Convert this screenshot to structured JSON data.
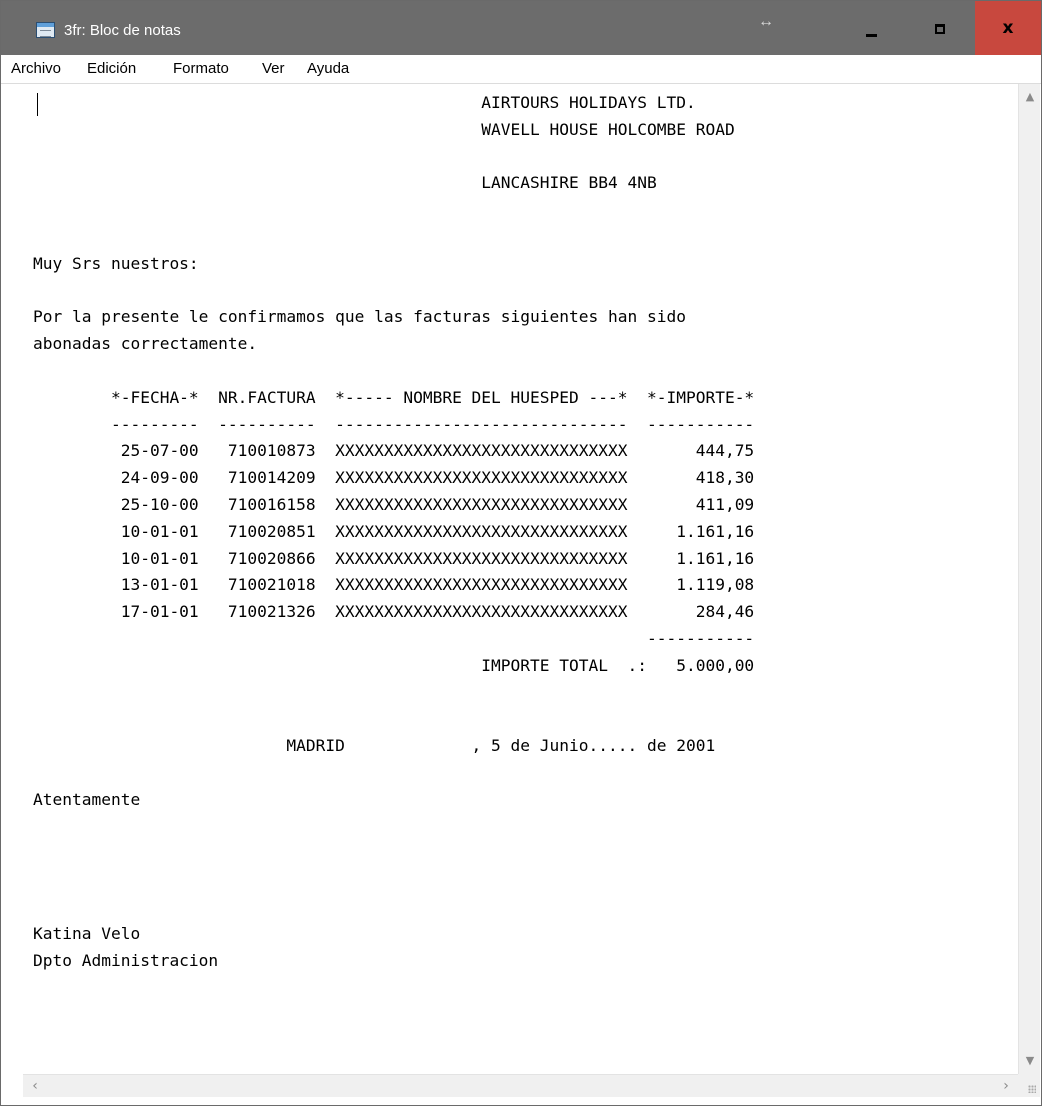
{
  "window": {
    "title": "3fr: Bloc de notas",
    "controls": {
      "minimize": "minimize",
      "maximize": "maximize",
      "close": "x"
    },
    "colors": {
      "titlebar": "#6c6c6c",
      "close_button": "#c8483e"
    }
  },
  "menu": {
    "items": [
      "Archivo",
      "Edición",
      "Formato",
      "Ver",
      "Ayuda"
    ]
  },
  "editor": {
    "text": "                                              AIRTOURS HOLIDAYS LTD.\n                                              WAVELL HOUSE HOLCOMBE ROAD\n\n                                              LANCASHIRE BB4 4NB\n\n\nMuy Srs nuestros:\n\nPor la presente le confirmamos que las facturas siguientes han sido\nabonadas correctamente.\n\n        *-FECHA-*  NR.FACTURA  *----- NOMBRE DEL HUESPED ---*  *-IMPORTE-*\n        ---------  ----------  ------------------------------  -----------\n         25-07-00   710010873  XXXXXXXXXXXXXXXXXXXXXXXXXXXXXX       444,75\n         24-09-00   710014209  XXXXXXXXXXXXXXXXXXXXXXXXXXXXXX       418,30\n         25-10-00   710016158  XXXXXXXXXXXXXXXXXXXXXXXXXXXXXX       411,09\n         10-01-01   710020851  XXXXXXXXXXXXXXXXXXXXXXXXXXXXXX     1.161,16\n         10-01-01   710020866  XXXXXXXXXXXXXXXXXXXXXXXXXXXXXX     1.161,16\n         13-01-01   710021018  XXXXXXXXXXXXXXXXXXXXXXXXXXXXXX     1.119,08\n         17-01-01   710021326  XXXXXXXXXXXXXXXXXXXXXXXXXXXXXX       284,46\n                                                               -----------\n                                              IMPORTE TOTAL  .:   5.000,00\n\n\n                          MADRID             , 5 de Junio..... de 2001\n\nAtentamente\n\n\n\n\nKatina Velo\nDpto Administracion"
  },
  "scrollbars": {
    "up": "^",
    "down": "v",
    "left": "<",
    "right": ">"
  }
}
